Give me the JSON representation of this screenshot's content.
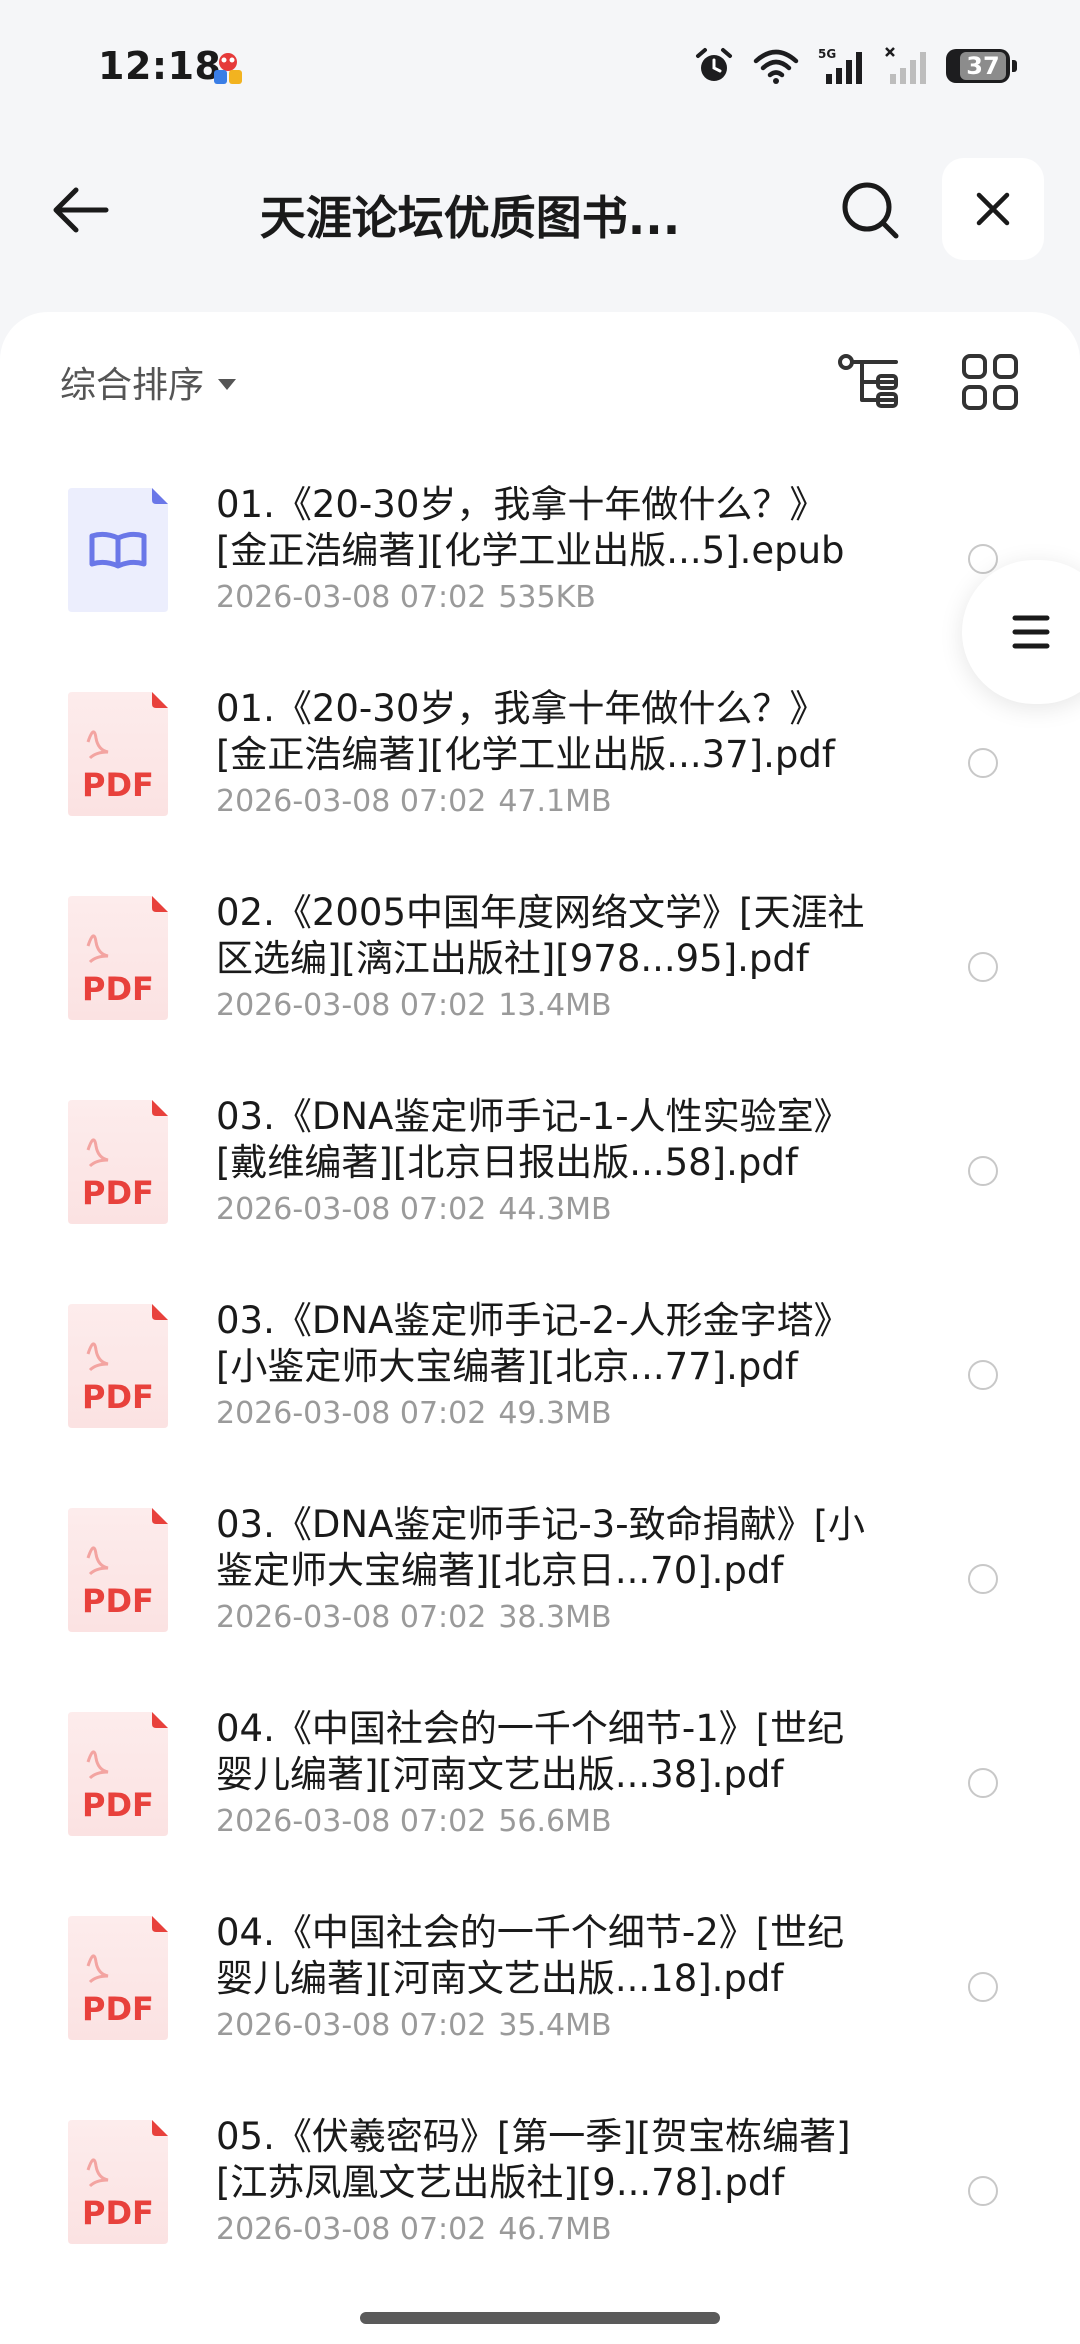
{
  "status_bar": {
    "time": "12:18",
    "network": "5G",
    "battery": "37"
  },
  "header": {
    "title": "天涯论坛优质图书..."
  },
  "toolbar": {
    "sort_label": "综合排序"
  },
  "files": [
    {
      "type": "epub",
      "name": "01.《20-30岁，我拿十年做什么？》[金正浩编著][化学工业出版...5].epub",
      "date": "2026-03-08 07:02",
      "size": "535KB"
    },
    {
      "type": "pdf",
      "name": "01.《20-30岁，我拿十年做什么？》[金正浩编著][化学工业出版...37].pdf",
      "date": "2026-03-08 07:02",
      "size": "47.1MB"
    },
    {
      "type": "pdf",
      "name": "02.《2005中国年度网络文学》[天涯社区选编][漓江出版社][978...95].pdf",
      "date": "2026-03-08 07:02",
      "size": "13.4MB"
    },
    {
      "type": "pdf",
      "name": "03.《DNA鉴定师手记-1-人性实验室》[戴维编著][北京日报出版...58].pdf",
      "date": "2026-03-08 07:02",
      "size": "44.3MB"
    },
    {
      "type": "pdf",
      "name": "03.《DNA鉴定师手记-2-人形金字塔》[小鉴定师大宝编著][北京...77].pdf",
      "date": "2026-03-08 07:02",
      "size": "49.3MB"
    },
    {
      "type": "pdf",
      "name": "03.《DNA鉴定师手记-3-致命捐献》[小鉴定师大宝编著][北京日...70].pdf",
      "date": "2026-03-08 07:02",
      "size": "38.3MB"
    },
    {
      "type": "pdf",
      "name": "04.《中国社会的一千个细节-1》[世纪婴儿编著][河南文艺出版...38].pdf",
      "date": "2026-03-08 07:02",
      "size": "56.6MB"
    },
    {
      "type": "pdf",
      "name": "04.《中国社会的一千个细节-2》[世纪婴儿编著][河南文艺出版...18].pdf",
      "date": "2026-03-08 07:02",
      "size": "35.4MB"
    },
    {
      "type": "pdf",
      "name": "05.《伏羲密码》[第一季][贺宝栋编著][江苏凤凰文艺出版社][9...78].pdf",
      "date": "2026-03-08 07:02",
      "size": "46.7MB"
    }
  ],
  "icons": {
    "back": "arrow-left-icon",
    "search": "search-icon",
    "close": "close-icon",
    "tree": "tree-view-icon",
    "grid": "grid-view-icon",
    "menu": "menu-icon"
  },
  "colors": {
    "pdf_red": "#e8413c",
    "epub_blue": "#6a77e8"
  },
  "pdf_label": "PDF"
}
